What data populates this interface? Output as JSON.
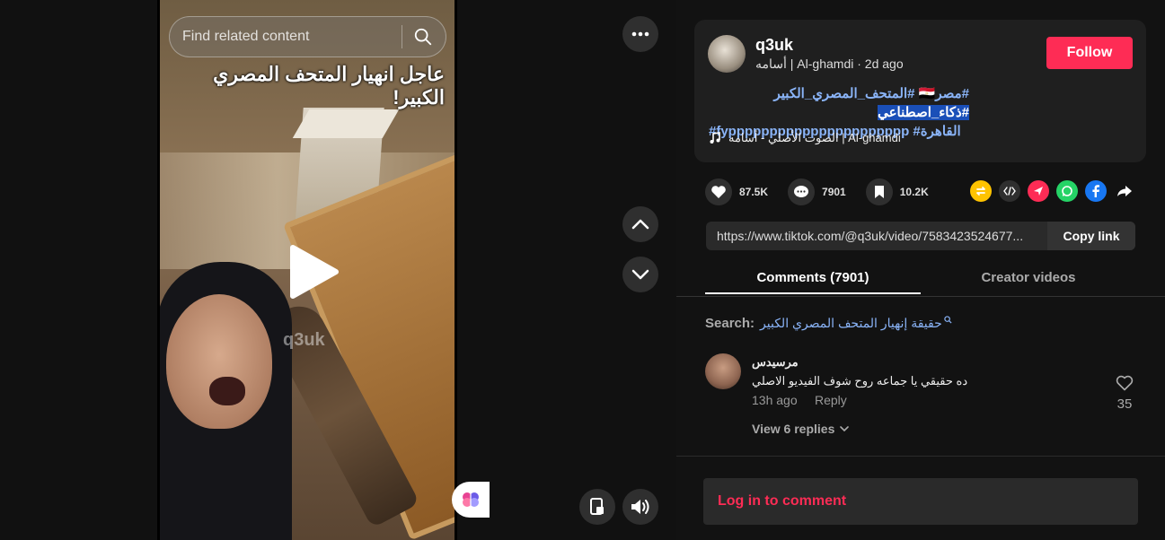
{
  "video": {
    "search_placeholder": "Find related content",
    "overlay_title": "عاجل انهيار المتحف المصري الكبير!",
    "watermark": "q3uk"
  },
  "post": {
    "username": "q3uk",
    "display_name": "أسامه | Al-ghamdi",
    "time_ago": "· 2d ago",
    "follow_label": "Follow",
    "hashtags_line1_prefix": "#مصر🇪🇬 #المتحف_المصري_الكبير ",
    "hashtags_line1_highlight": "#ذكاء_اصطناعي",
    "hashtags_line2": "#fypppppppppppppppppppppp #القاهرة",
    "music": "الصوت الأصلي - أسامه | Al-ghamdi"
  },
  "stats": {
    "likes": "87.5K",
    "comments": "7901",
    "saves": "10.2K"
  },
  "share_icons": [
    "repost-icon",
    "embed-icon",
    "send-icon",
    "whatsapp-icon",
    "facebook-icon",
    "share-arrow-icon"
  ],
  "colors": {
    "accent": "#fe2c55",
    "link": "#8ab4f8",
    "whatsapp": "#25d366",
    "facebook": "#1877f2",
    "repost": "#ffc300"
  },
  "link": {
    "url": "https://www.tiktok.com/@q3uk/video/7583423524677...",
    "copy_label": "Copy link"
  },
  "tabs": {
    "comments": "Comments (7901)",
    "creator_videos": "Creator videos"
  },
  "search": {
    "label": "Search:",
    "query": "حقيقة إنهيار المتحف المصري الكبير"
  },
  "comment": {
    "author": "مرسيدس",
    "text": "ده حقيقي يا جماعه روح شوف الفيديو الاصلي",
    "time": "13h ago",
    "reply": "Reply",
    "likes": "35",
    "view_replies": "View 6 replies"
  },
  "footer": {
    "login": "Log in to comment"
  }
}
